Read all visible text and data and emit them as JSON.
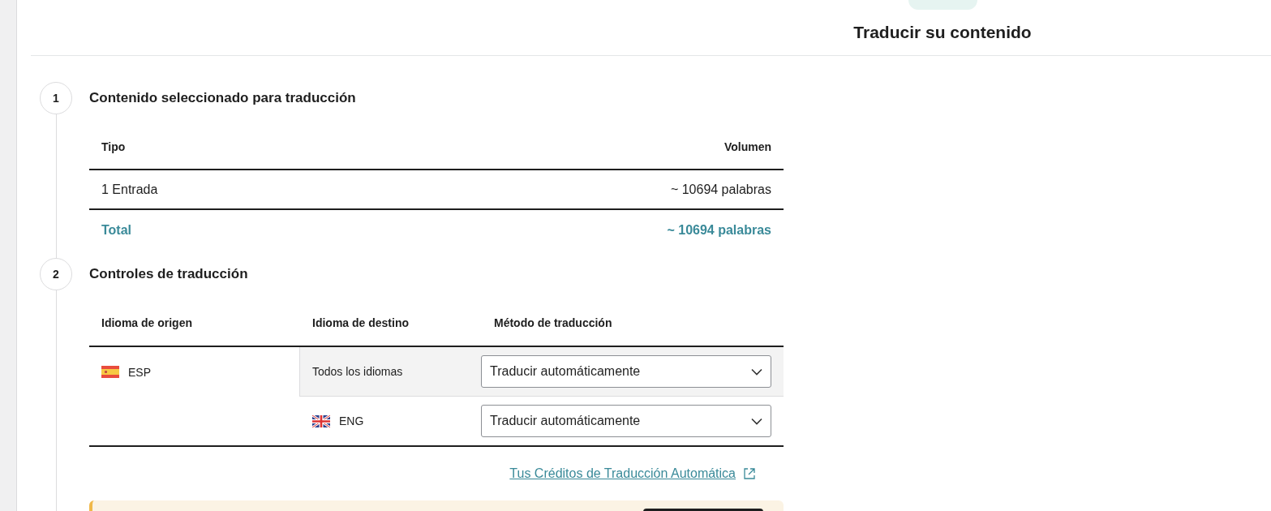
{
  "header": {
    "title": "Traducir su contenido"
  },
  "steps": [
    {
      "kind": "summary",
      "number": "1",
      "title": "Contenido seleccionado para traducción",
      "columns": [
        "Tipo",
        "Volumen"
      ],
      "rows": [
        {
          "type": "1 Entrada",
          "volume": "~ 10694 palabras"
        }
      ],
      "total": {
        "label": "Total",
        "volume": "~ 10694 palabras"
      }
    },
    {
      "kind": "controls",
      "number": "2",
      "title": "Controles de traducción",
      "columns": [
        "Idioma de origen",
        "Idioma de destino",
        "Método de traducción"
      ],
      "source": {
        "code": "ESP"
      },
      "targets": [
        {
          "kind": "all",
          "label": "Todos los idiomas",
          "method": "Traducir automáticamente"
        },
        {
          "kind": "language",
          "label": "ENG",
          "method": "Traducir automáticamente"
        }
      ],
      "link": "Tus Créditos de Traducción Automática"
    }
  ]
}
